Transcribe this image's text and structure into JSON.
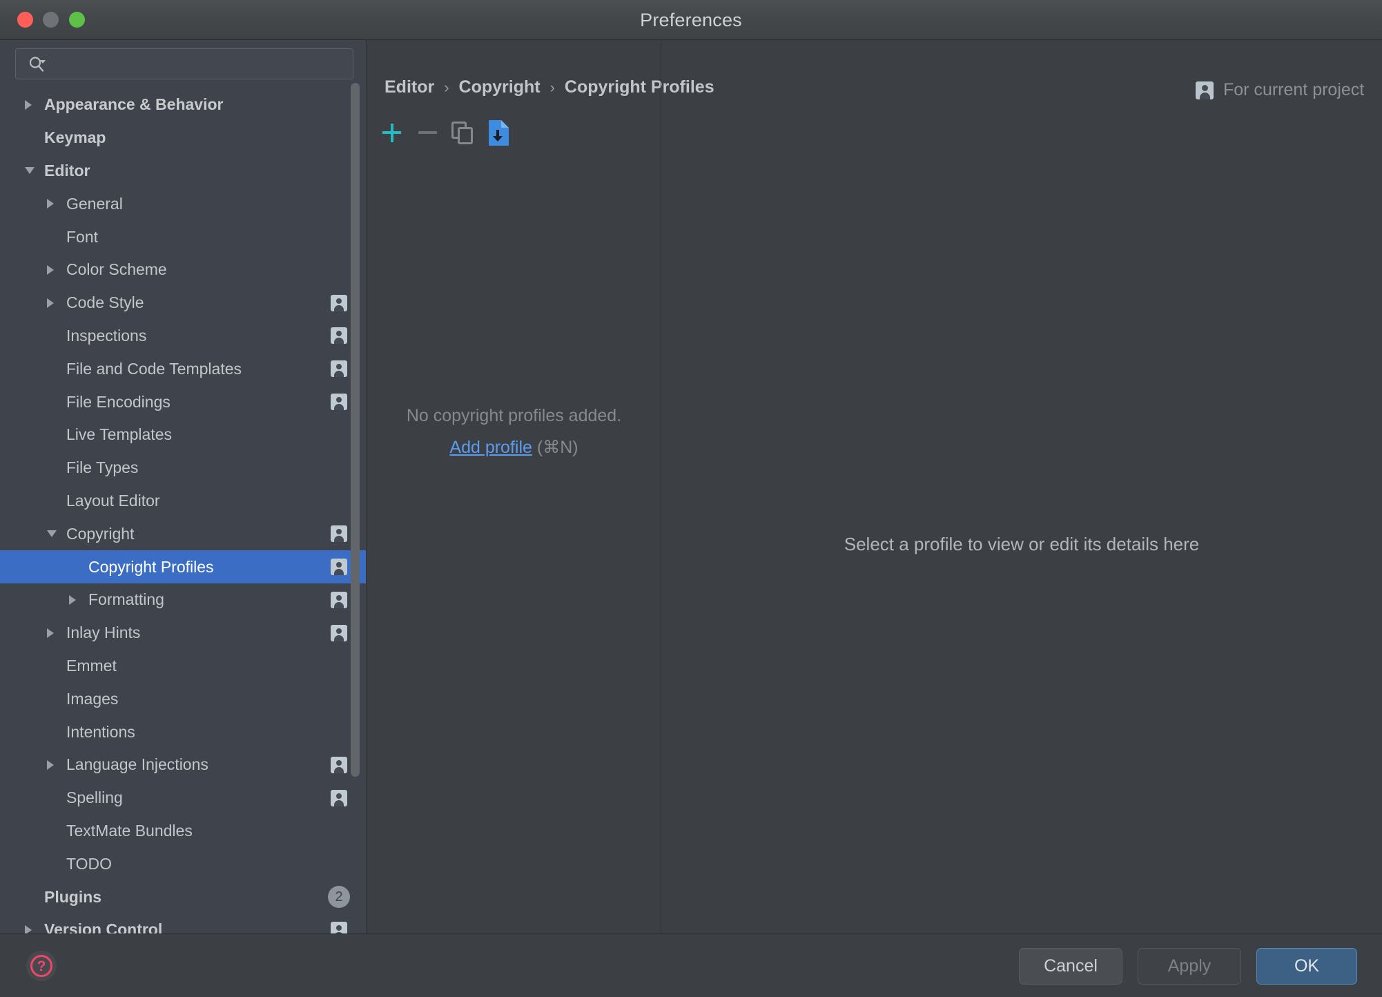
{
  "window": {
    "title": "Preferences",
    "traffic_lights": [
      "close",
      "minimize",
      "maximize"
    ]
  },
  "sidebar": {
    "search": {
      "value": "",
      "placeholder": "",
      "icon": "search-icon"
    },
    "items": [
      {
        "label": "Appearance & Behavior",
        "indent": 0,
        "arrow": "right",
        "bold": true,
        "badge": null,
        "project": false,
        "selected": false
      },
      {
        "label": "Keymap",
        "indent": 0,
        "arrow": "none",
        "bold": true,
        "badge": null,
        "project": false,
        "selected": false
      },
      {
        "label": "Editor",
        "indent": 0,
        "arrow": "down",
        "bold": true,
        "badge": null,
        "project": false,
        "selected": false
      },
      {
        "label": "General",
        "indent": 1,
        "arrow": "right",
        "bold": false,
        "badge": null,
        "project": false,
        "selected": false
      },
      {
        "label": "Font",
        "indent": 1,
        "arrow": "none",
        "bold": false,
        "badge": null,
        "project": false,
        "selected": false
      },
      {
        "label": "Color Scheme",
        "indent": 1,
        "arrow": "right",
        "bold": false,
        "badge": null,
        "project": false,
        "selected": false
      },
      {
        "label": "Code Style",
        "indent": 1,
        "arrow": "right",
        "bold": false,
        "badge": null,
        "project": true,
        "selected": false
      },
      {
        "label": "Inspections",
        "indent": 1,
        "arrow": "none",
        "bold": false,
        "badge": null,
        "project": true,
        "selected": false
      },
      {
        "label": "File and Code Templates",
        "indent": 1,
        "arrow": "none",
        "bold": false,
        "badge": null,
        "project": true,
        "selected": false
      },
      {
        "label": "File Encodings",
        "indent": 1,
        "arrow": "none",
        "bold": false,
        "badge": null,
        "project": true,
        "selected": false
      },
      {
        "label": "Live Templates",
        "indent": 1,
        "arrow": "none",
        "bold": false,
        "badge": null,
        "project": false,
        "selected": false
      },
      {
        "label": "File Types",
        "indent": 1,
        "arrow": "none",
        "bold": false,
        "badge": null,
        "project": false,
        "selected": false
      },
      {
        "label": "Layout Editor",
        "indent": 1,
        "arrow": "none",
        "bold": false,
        "badge": null,
        "project": false,
        "selected": false
      },
      {
        "label": "Copyright",
        "indent": 1,
        "arrow": "down",
        "bold": false,
        "badge": null,
        "project": true,
        "selected": false
      },
      {
        "label": "Copyright Profiles",
        "indent": 2,
        "arrow": "none",
        "bold": false,
        "badge": null,
        "project": true,
        "selected": true
      },
      {
        "label": "Formatting",
        "indent": 2,
        "arrow": "right",
        "bold": false,
        "badge": null,
        "project": true,
        "selected": false
      },
      {
        "label": "Inlay Hints",
        "indent": 1,
        "arrow": "right",
        "bold": false,
        "badge": null,
        "project": true,
        "selected": false
      },
      {
        "label": "Emmet",
        "indent": 1,
        "arrow": "none",
        "bold": false,
        "badge": null,
        "project": false,
        "selected": false
      },
      {
        "label": "Images",
        "indent": 1,
        "arrow": "none",
        "bold": false,
        "badge": null,
        "project": false,
        "selected": false
      },
      {
        "label": "Intentions",
        "indent": 1,
        "arrow": "none",
        "bold": false,
        "badge": null,
        "project": false,
        "selected": false
      },
      {
        "label": "Language Injections",
        "indent": 1,
        "arrow": "right",
        "bold": false,
        "badge": null,
        "project": true,
        "selected": false
      },
      {
        "label": "Spelling",
        "indent": 1,
        "arrow": "none",
        "bold": false,
        "badge": null,
        "project": true,
        "selected": false
      },
      {
        "label": "TextMate Bundles",
        "indent": 1,
        "arrow": "none",
        "bold": false,
        "badge": null,
        "project": false,
        "selected": false
      },
      {
        "label": "TODO",
        "indent": 1,
        "arrow": "none",
        "bold": false,
        "badge": null,
        "project": false,
        "selected": false
      },
      {
        "label": "Plugins",
        "indent": 0,
        "arrow": "none",
        "bold": true,
        "badge": "2",
        "project": false,
        "selected": false
      },
      {
        "label": "Version Control",
        "indent": 0,
        "arrow": "right",
        "bold": true,
        "badge": null,
        "project": true,
        "selected": false
      }
    ],
    "scrollbar": {
      "name": "sidebar-scrollbar"
    }
  },
  "main": {
    "breadcrumb": {
      "items": [
        "Editor",
        "Copyright",
        "Copyright Profiles"
      ],
      "separator": "›"
    },
    "for_current_project": {
      "label": "For current project",
      "icon": "project-scope-icon"
    },
    "toolbar": {
      "add": {
        "name": "add-profile-button",
        "icon": "plus-icon",
        "color": "#27b9c4"
      },
      "remove": {
        "name": "remove-profile-button",
        "icon": "minus-icon",
        "color": "#6d7175"
      },
      "copy": {
        "name": "copy-profile-button",
        "icon": "copy-icon",
        "color": "#85898d"
      },
      "import": {
        "name": "import-profile-button",
        "icon": "import-file-icon",
        "color": "#3d8ce0"
      }
    },
    "empty_state": {
      "message": "No copyright profiles added.",
      "link": "Add profile",
      "shortcut": "(⌘N)"
    },
    "detail_placeholder": "Select a profile to view or edit its details here"
  },
  "footer": {
    "help": {
      "name": "help-button",
      "glyph": "?",
      "color": "#f14668"
    },
    "cancel": "Cancel",
    "apply": "Apply",
    "ok": "OK"
  },
  "colors": {
    "selection_blue": "#3b6dc4",
    "link_blue": "#5b9bf0",
    "accent_teal": "#27b9c4",
    "ok_button_blue": "#3d6185",
    "help_red": "#f14668"
  }
}
